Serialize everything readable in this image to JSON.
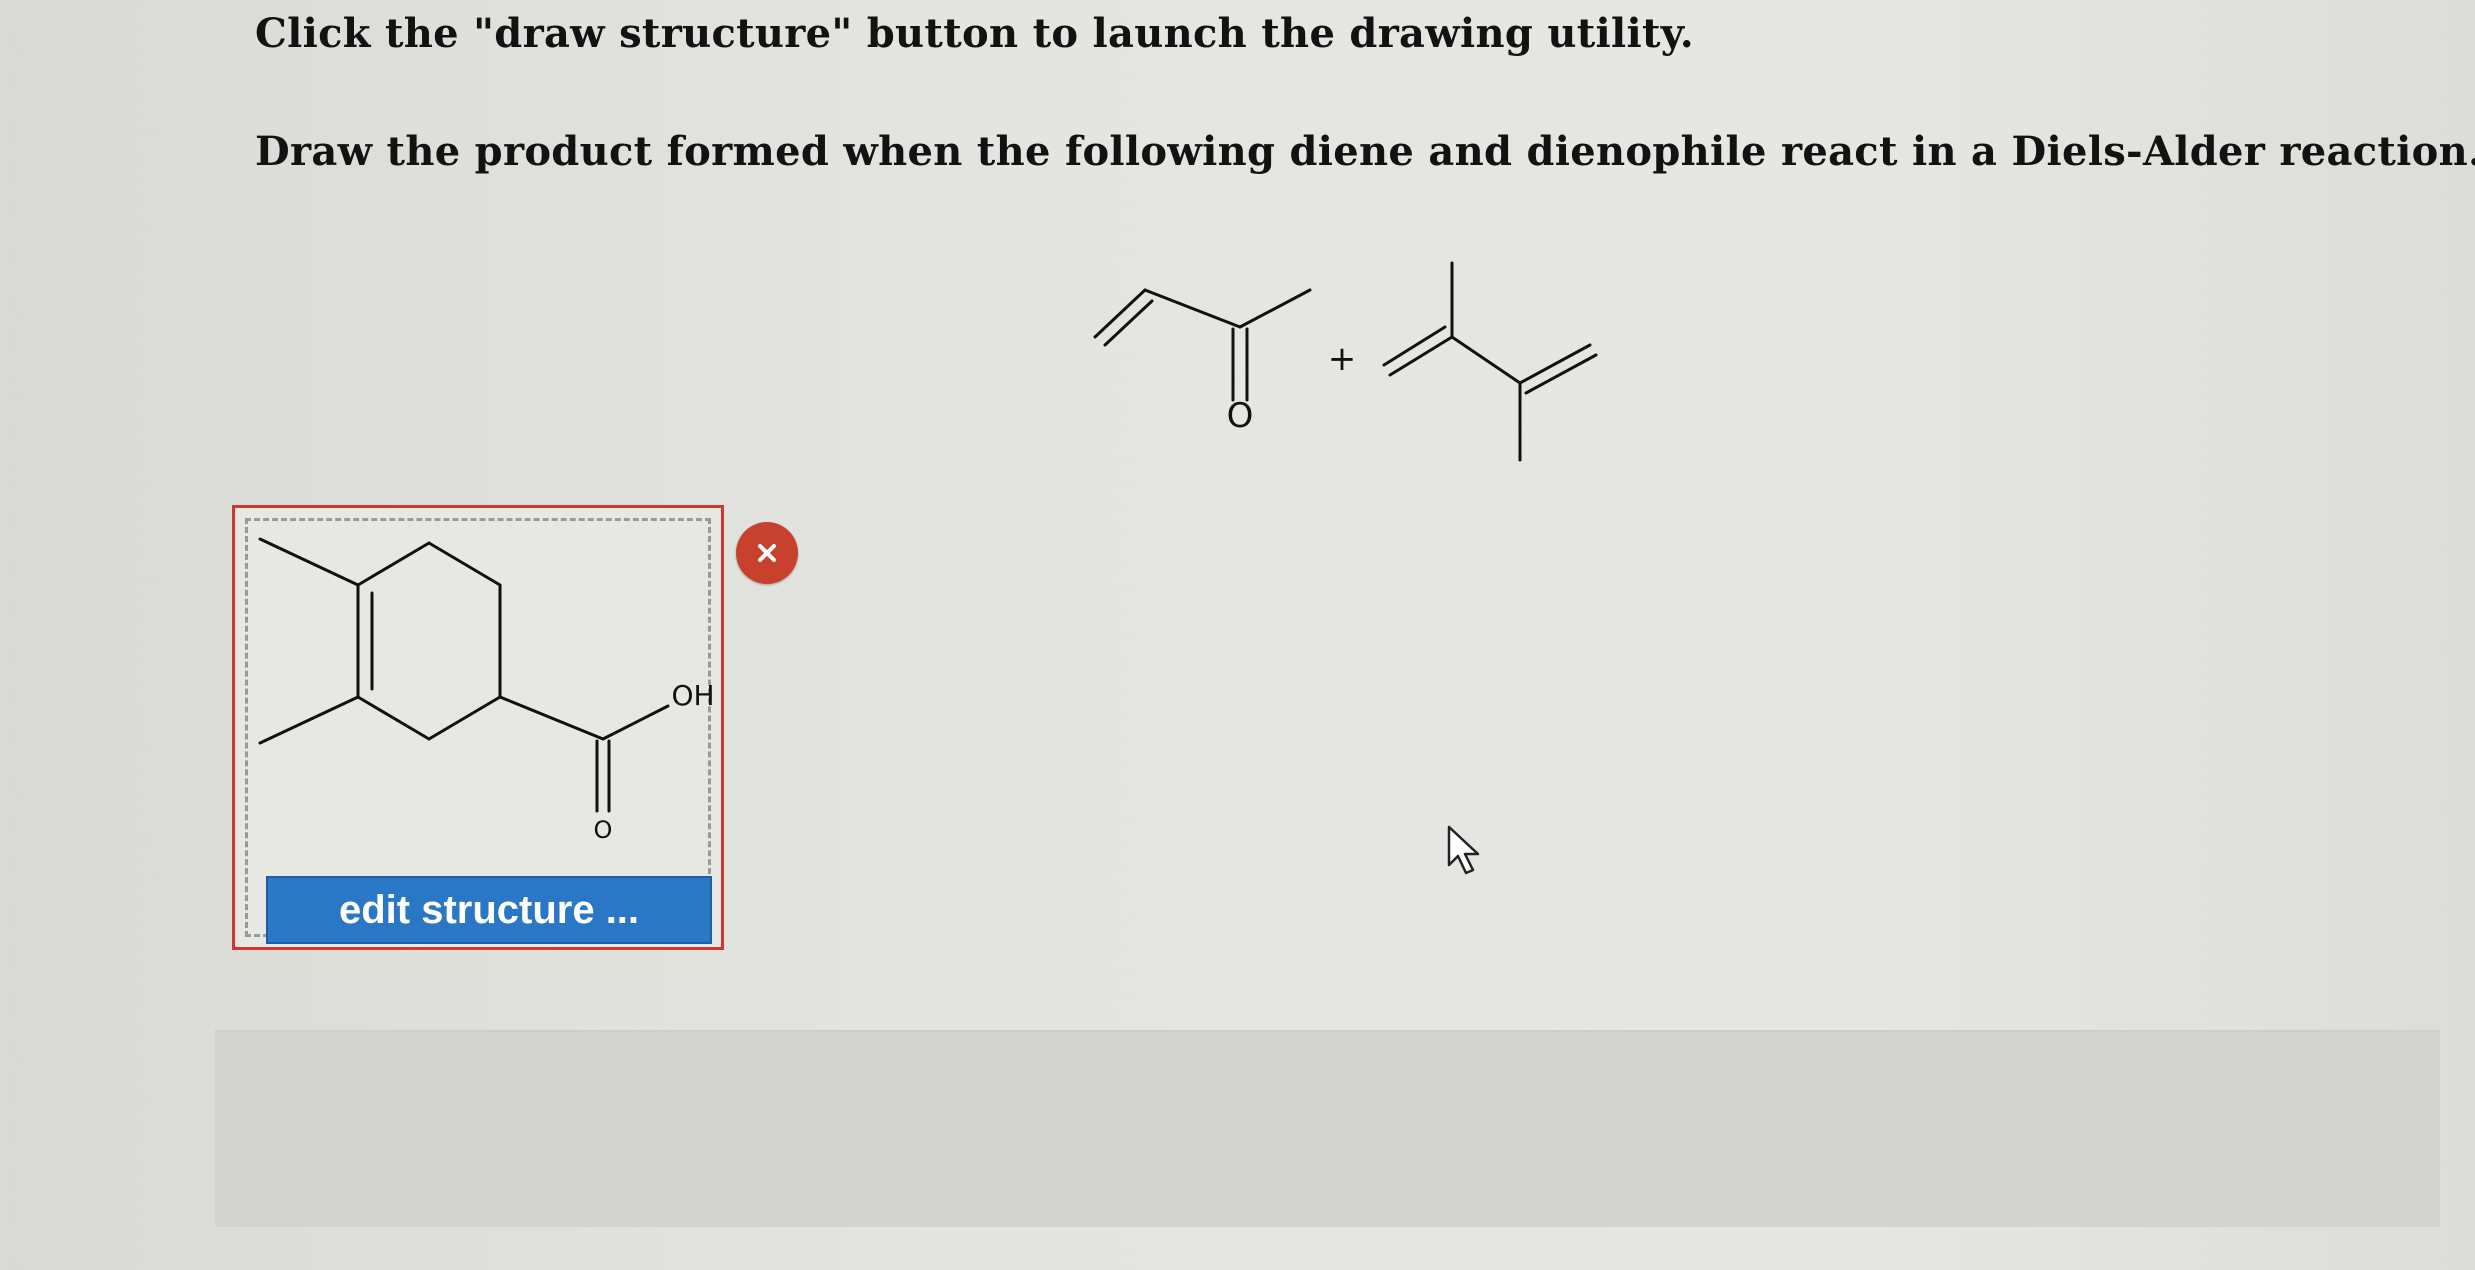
{
  "question": {
    "instruction_line1": "Click the \"draw structure\" button to launch the drawing utility.",
    "instruction_line2": "Draw the product formed when the following diene and dienophile react in a Diels-Alder reaction."
  },
  "reaction": {
    "dienophile_atom_label": "O",
    "plus_sign": "+"
  },
  "answer": {
    "product_oh_label": "OH",
    "product_o_label": "O",
    "edit_button_label": "edit structure ..."
  },
  "icons": {
    "clear": "close-icon",
    "cursor": "mouse-pointer-icon"
  },
  "colors": {
    "answer_border": "#d2372f",
    "edit_button": "#2a77c6",
    "clear_button": "#c8412f"
  }
}
